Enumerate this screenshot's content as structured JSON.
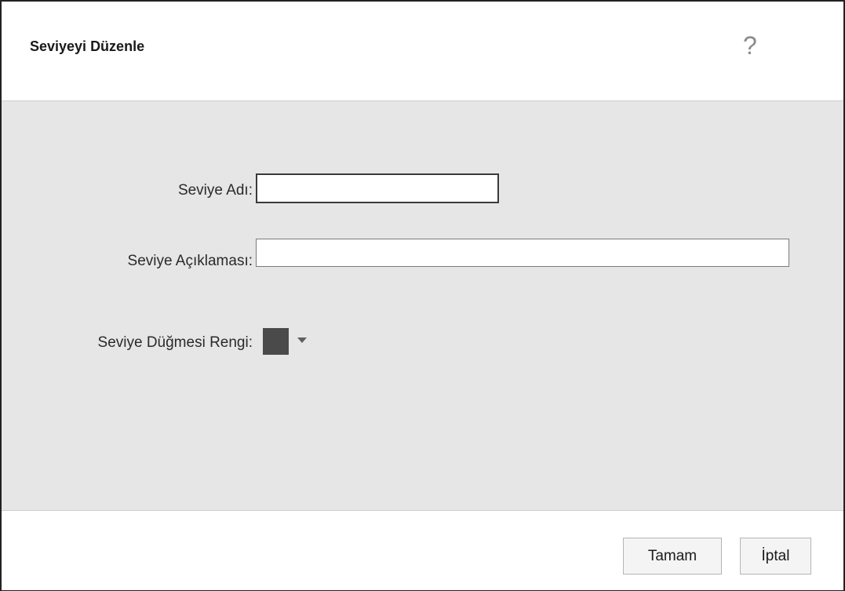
{
  "dialog": {
    "title": "Seviyeyi Düzenle",
    "help_icon": "question-mark-icon",
    "help_glyph": "?"
  },
  "form": {
    "level_name_label": "Seviye Adı:",
    "level_name_value": "",
    "level_description_label": "Seviye Açıklaması:",
    "level_description_value": "",
    "button_color_label": "Seviye Düğmesi Rengi:",
    "button_color_value": "#4a4a4a"
  },
  "footer": {
    "ok_label": "Tamam",
    "cancel_label": "İptal"
  },
  "colors": {
    "body_background": "#e6e6e6",
    "header_background": "#ffffff",
    "border": "#222222"
  }
}
